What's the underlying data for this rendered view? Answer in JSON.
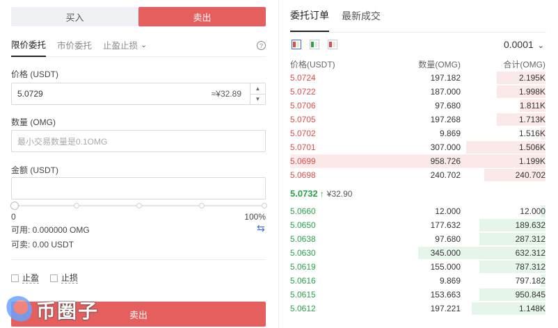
{
  "trade": {
    "buy_tab": "买入",
    "sell_tab": "卖出",
    "order_types": [
      "限价委托",
      "市价委托",
      "止盈止损"
    ],
    "price": {
      "label": "价格 (USDT)",
      "value": "5.0729",
      "converted": "≈¥32.89"
    },
    "quantity": {
      "label": "数量 (OMG)",
      "placeholder": "最小交易数量是0.1OMG"
    },
    "amount": {
      "label": "金额 (USDT)",
      "value": ""
    },
    "slider": {
      "min_label": "0",
      "max_label": "100%",
      "percent": 0
    },
    "available": "可用: 0.000000 OMG",
    "sellable": "可卖: 0.00 USDT",
    "take_profit": "止盈",
    "stop_loss": "止损",
    "submit": "卖出",
    "watermark": "币圈子"
  },
  "orderbook": {
    "tabs": [
      "委托订单",
      "最新成交"
    ],
    "precision": "0.0001",
    "headers": {
      "price": "价格(USDT)",
      "qty": "数量(OMG)",
      "sum": "合计(OMG)"
    },
    "asks": [
      {
        "price": "5.0724",
        "qty": "197.182",
        "sum": "2.195K",
        "depth": 0.19
      },
      {
        "price": "5.0722",
        "qty": "187.000",
        "sum": "1.998K",
        "depth": 0.19
      },
      {
        "price": "5.0706",
        "qty": "97.680",
        "sum": "1.811K",
        "depth": 0.1
      },
      {
        "price": "5.0705",
        "qty": "197.268",
        "sum": "1.713K",
        "depth": 0.19
      },
      {
        "price": "5.0702",
        "qty": "9.869",
        "sum": "1.516K",
        "depth": 0.02
      },
      {
        "price": "5.0701",
        "qty": "307.000",
        "sum": "1.506K",
        "depth": 0.31
      },
      {
        "price": "5.0699",
        "qty": "958.726",
        "sum": "1.199K",
        "depth": 0.96,
        "highlight": true
      },
      {
        "price": "5.0698",
        "qty": "240.702",
        "sum": "240.702",
        "depth": 0.24
      }
    ],
    "last_price": "5.0732",
    "last_price_cny": "¥32.90",
    "bids": [
      {
        "price": "5.0660",
        "qty": "12.000",
        "sum": "12.000",
        "depth": 0.02
      },
      {
        "price": "5.0650",
        "qty": "177.632",
        "sum": "189.632",
        "depth": 0.26
      },
      {
        "price": "5.0638",
        "qty": "97.680",
        "sum": "287.312",
        "depth": 0.26
      },
      {
        "price": "5.0630",
        "qty": "345.000",
        "sum": "632.312",
        "depth": 0.5
      },
      {
        "price": "5.0619",
        "qty": "155.000",
        "sum": "787.312",
        "depth": 0.26
      },
      {
        "price": "5.0616",
        "qty": "9.869",
        "sum": "797.182",
        "depth": 0.02
      },
      {
        "price": "5.0615",
        "qty": "153.663",
        "sum": "950.845",
        "depth": 0.26
      },
      {
        "price": "5.0612",
        "qty": "197.221",
        "sum": "1.148K",
        "depth": 0.29
      }
    ]
  },
  "colors": {
    "sell": "#e55f5f",
    "ask": "#e24b4b",
    "bid": "#2aa34a",
    "accent": "#3a6fe0"
  }
}
